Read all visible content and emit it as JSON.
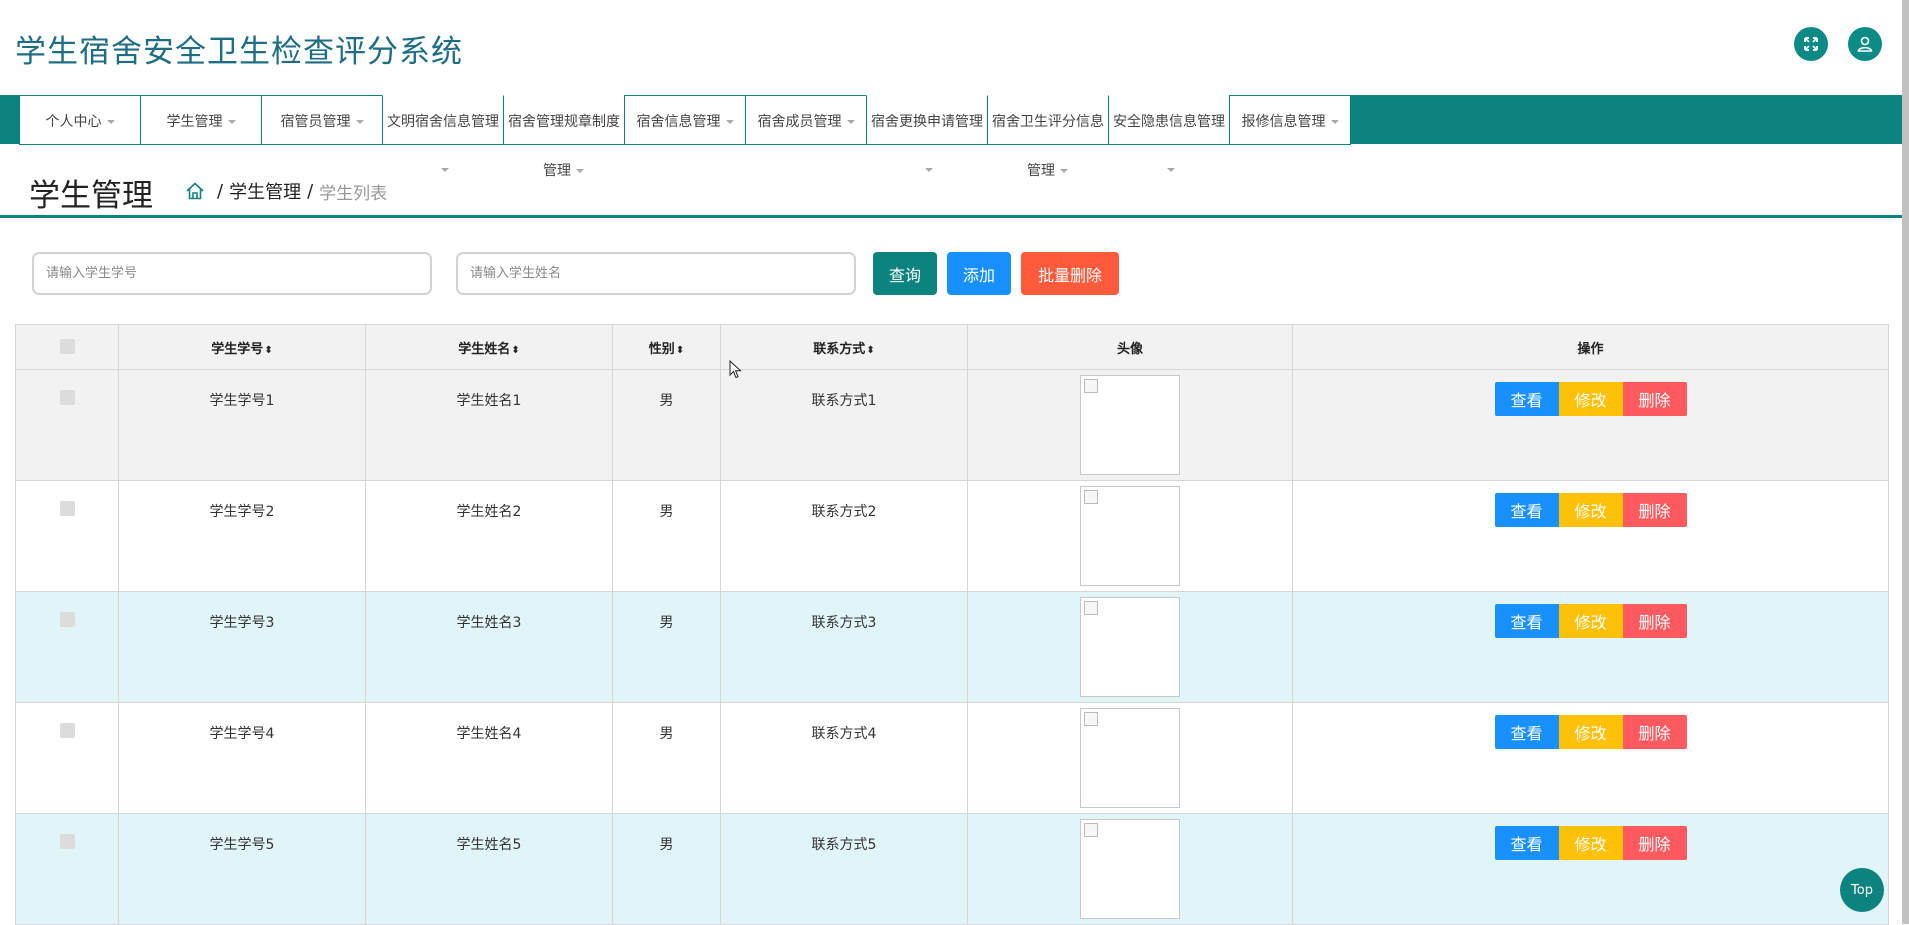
{
  "app": {
    "title": "学生宿舍安全卫生检查评分系统"
  },
  "header": {
    "fullscreen_icon": "expand-icon",
    "user_icon": "user-icon"
  },
  "nav": {
    "items": [
      {
        "label": "个人中心",
        "caret": true
      },
      {
        "label": "学生管理",
        "caret": true
      },
      {
        "label": "宿管员管理",
        "caret": true
      },
      {
        "label": "文明宿舍信息管理",
        "caret": false
      },
      {
        "label": "宿舍管理规章制度",
        "caret": false
      },
      {
        "label": "宿舍信息管理",
        "caret": true
      },
      {
        "label": "宿舍成员管理",
        "caret": true
      },
      {
        "label": "宿舍更换申请管理",
        "caret": false
      },
      {
        "label": "宿舍卫生评分信息",
        "caret": false
      },
      {
        "label": "安全隐患信息管理",
        "caret": false
      },
      {
        "label": "报修信息管理",
        "caret": true
      }
    ],
    "overflow_rules": "管理",
    "overflow_score": "管理"
  },
  "page": {
    "title": "学生管理",
    "breadcrumb": {
      "section": "学生管理",
      "current": "学生列表",
      "separator": "/"
    }
  },
  "search": {
    "student_no_placeholder": "请输入学生学号",
    "student_name_placeholder": "请输入学生姓名",
    "query_label": "查询",
    "add_label": "添加",
    "batch_delete_label": "批量删除"
  },
  "table": {
    "columns": [
      "学生学号",
      "学生姓名",
      "性别",
      "联系方式",
      "头像",
      "操作"
    ],
    "rows": [
      {
        "student_no": "学生学号1",
        "name": "学生姓名1",
        "gender": "男",
        "contact": "联系方式1"
      },
      {
        "student_no": "学生学号2",
        "name": "学生姓名2",
        "gender": "男",
        "contact": "联系方式2"
      },
      {
        "student_no": "学生学号3",
        "name": "学生姓名3",
        "gender": "男",
        "contact": "联系方式3"
      },
      {
        "student_no": "学生学号4",
        "name": "学生姓名4",
        "gender": "男",
        "contact": "联系方式4"
      },
      {
        "student_no": "学生学号5",
        "name": "学生姓名5",
        "gender": "男",
        "contact": "联系方式5"
      }
    ],
    "actions": {
      "view": "查看",
      "edit": "修改",
      "delete": "删除"
    }
  },
  "colors": {
    "primary": "#0d837f",
    "view": "#1890ff",
    "edit": "#ffc107",
    "delete": "#ff5a5f",
    "title": "#1f6d84"
  },
  "back_to_top": "Top"
}
